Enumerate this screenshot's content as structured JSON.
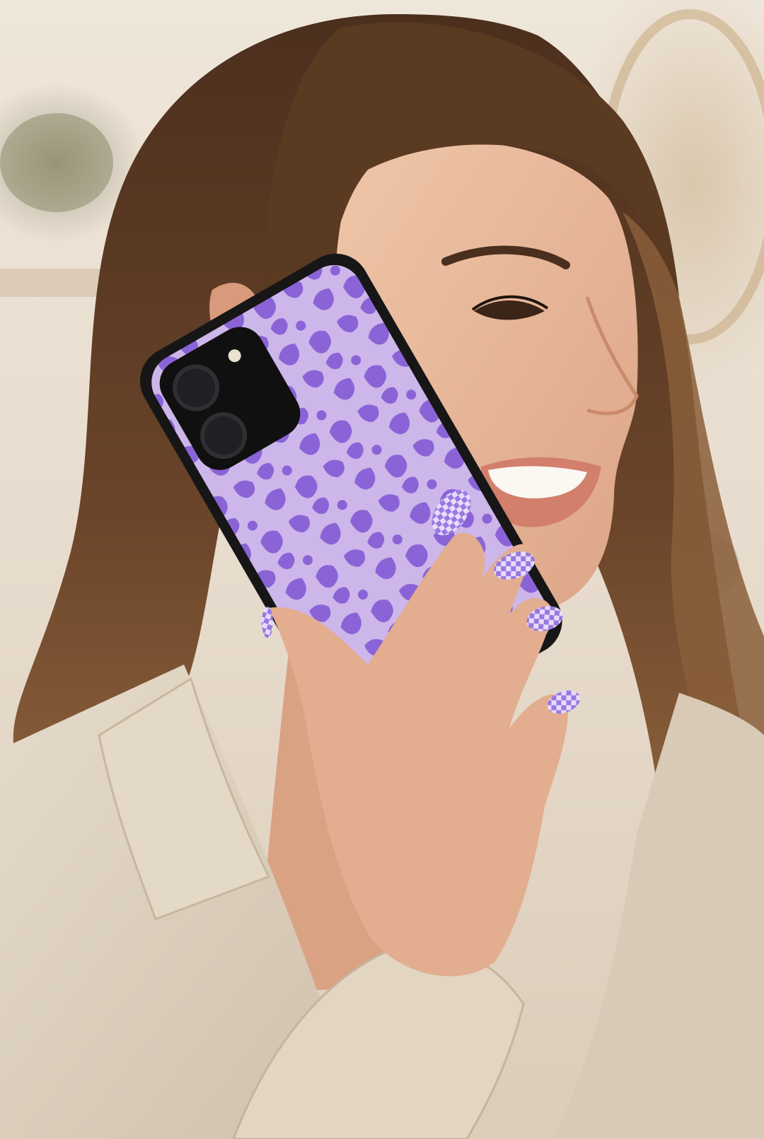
{
  "photo": {
    "subject": "smiling-woman-on-phone",
    "palette": {
      "background": "#e9dfd2",
      "hair_dark": "#5a3a24",
      "hair_light": "#a8784c",
      "skin": "#e9b898",
      "blazer": "#ddd0bd",
      "case_light": "#cdb6ea",
      "case_spots": "#8a63d6",
      "phone_frame": "#161616",
      "nail_base": "#e6dcfb",
      "nail_check": "#9a78e0"
    }
  }
}
